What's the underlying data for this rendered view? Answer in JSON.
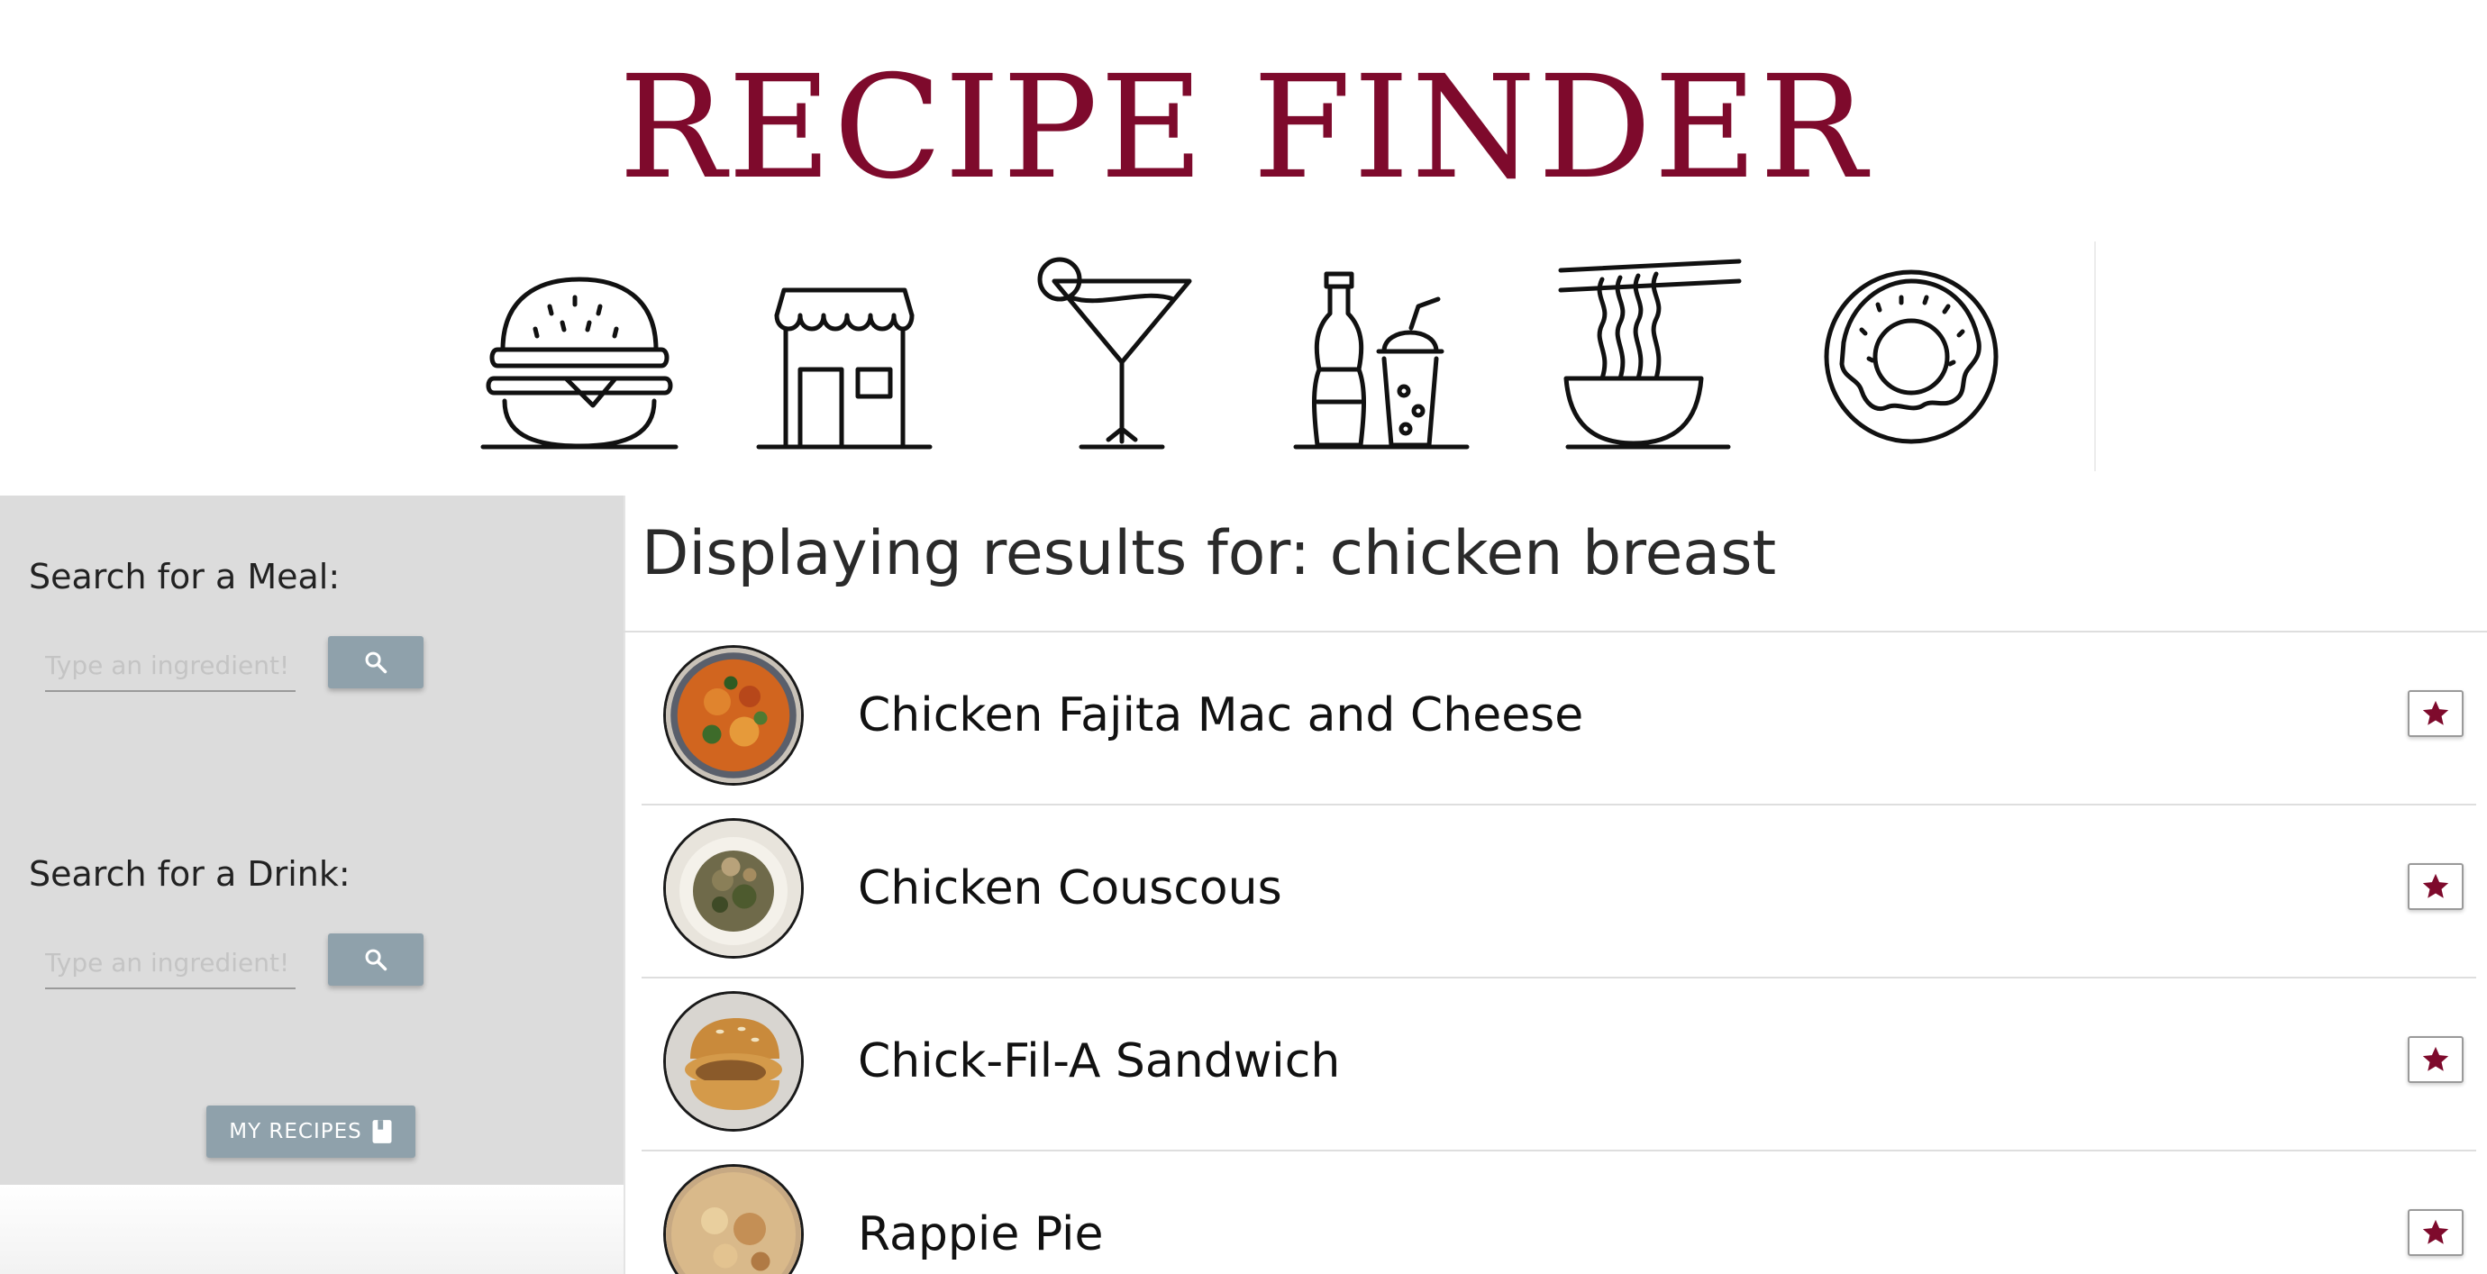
{
  "app": {
    "title": "RECIPE FINDER"
  },
  "header_icons": [
    {
      "name": "burger-icon"
    },
    {
      "name": "storefront-icon"
    },
    {
      "name": "cocktail-icon"
    },
    {
      "name": "soda-drinks-icon"
    },
    {
      "name": "noodle-bowl-icon"
    },
    {
      "name": "donut-icon"
    }
  ],
  "sidebar": {
    "meal_search": {
      "label": "Search for a Meal:",
      "placeholder": "Type an ingredient!",
      "value": ""
    },
    "drink_search": {
      "label": "Search for a Drink:",
      "placeholder": "Type an ingredient!",
      "value": ""
    },
    "search_button_icon": "search-icon",
    "my_recipes_label": "MY RECIPES",
    "my_recipes_icon": "book-icon"
  },
  "results": {
    "heading": "Displaying results for: chicken breast",
    "items": [
      {
        "name": "Chicken Fajita Mac and Cheese"
      },
      {
        "name": "Chicken Couscous"
      },
      {
        "name": "Chick-Fil-A Sandwich"
      },
      {
        "name": "Rappie Pie"
      }
    ],
    "favorite_icon": "star-icon"
  },
  "colors": {
    "brand": "#7e0a2c",
    "sidebar_bg": "#dcdcdc",
    "button_bg": "#8fa1ab"
  }
}
